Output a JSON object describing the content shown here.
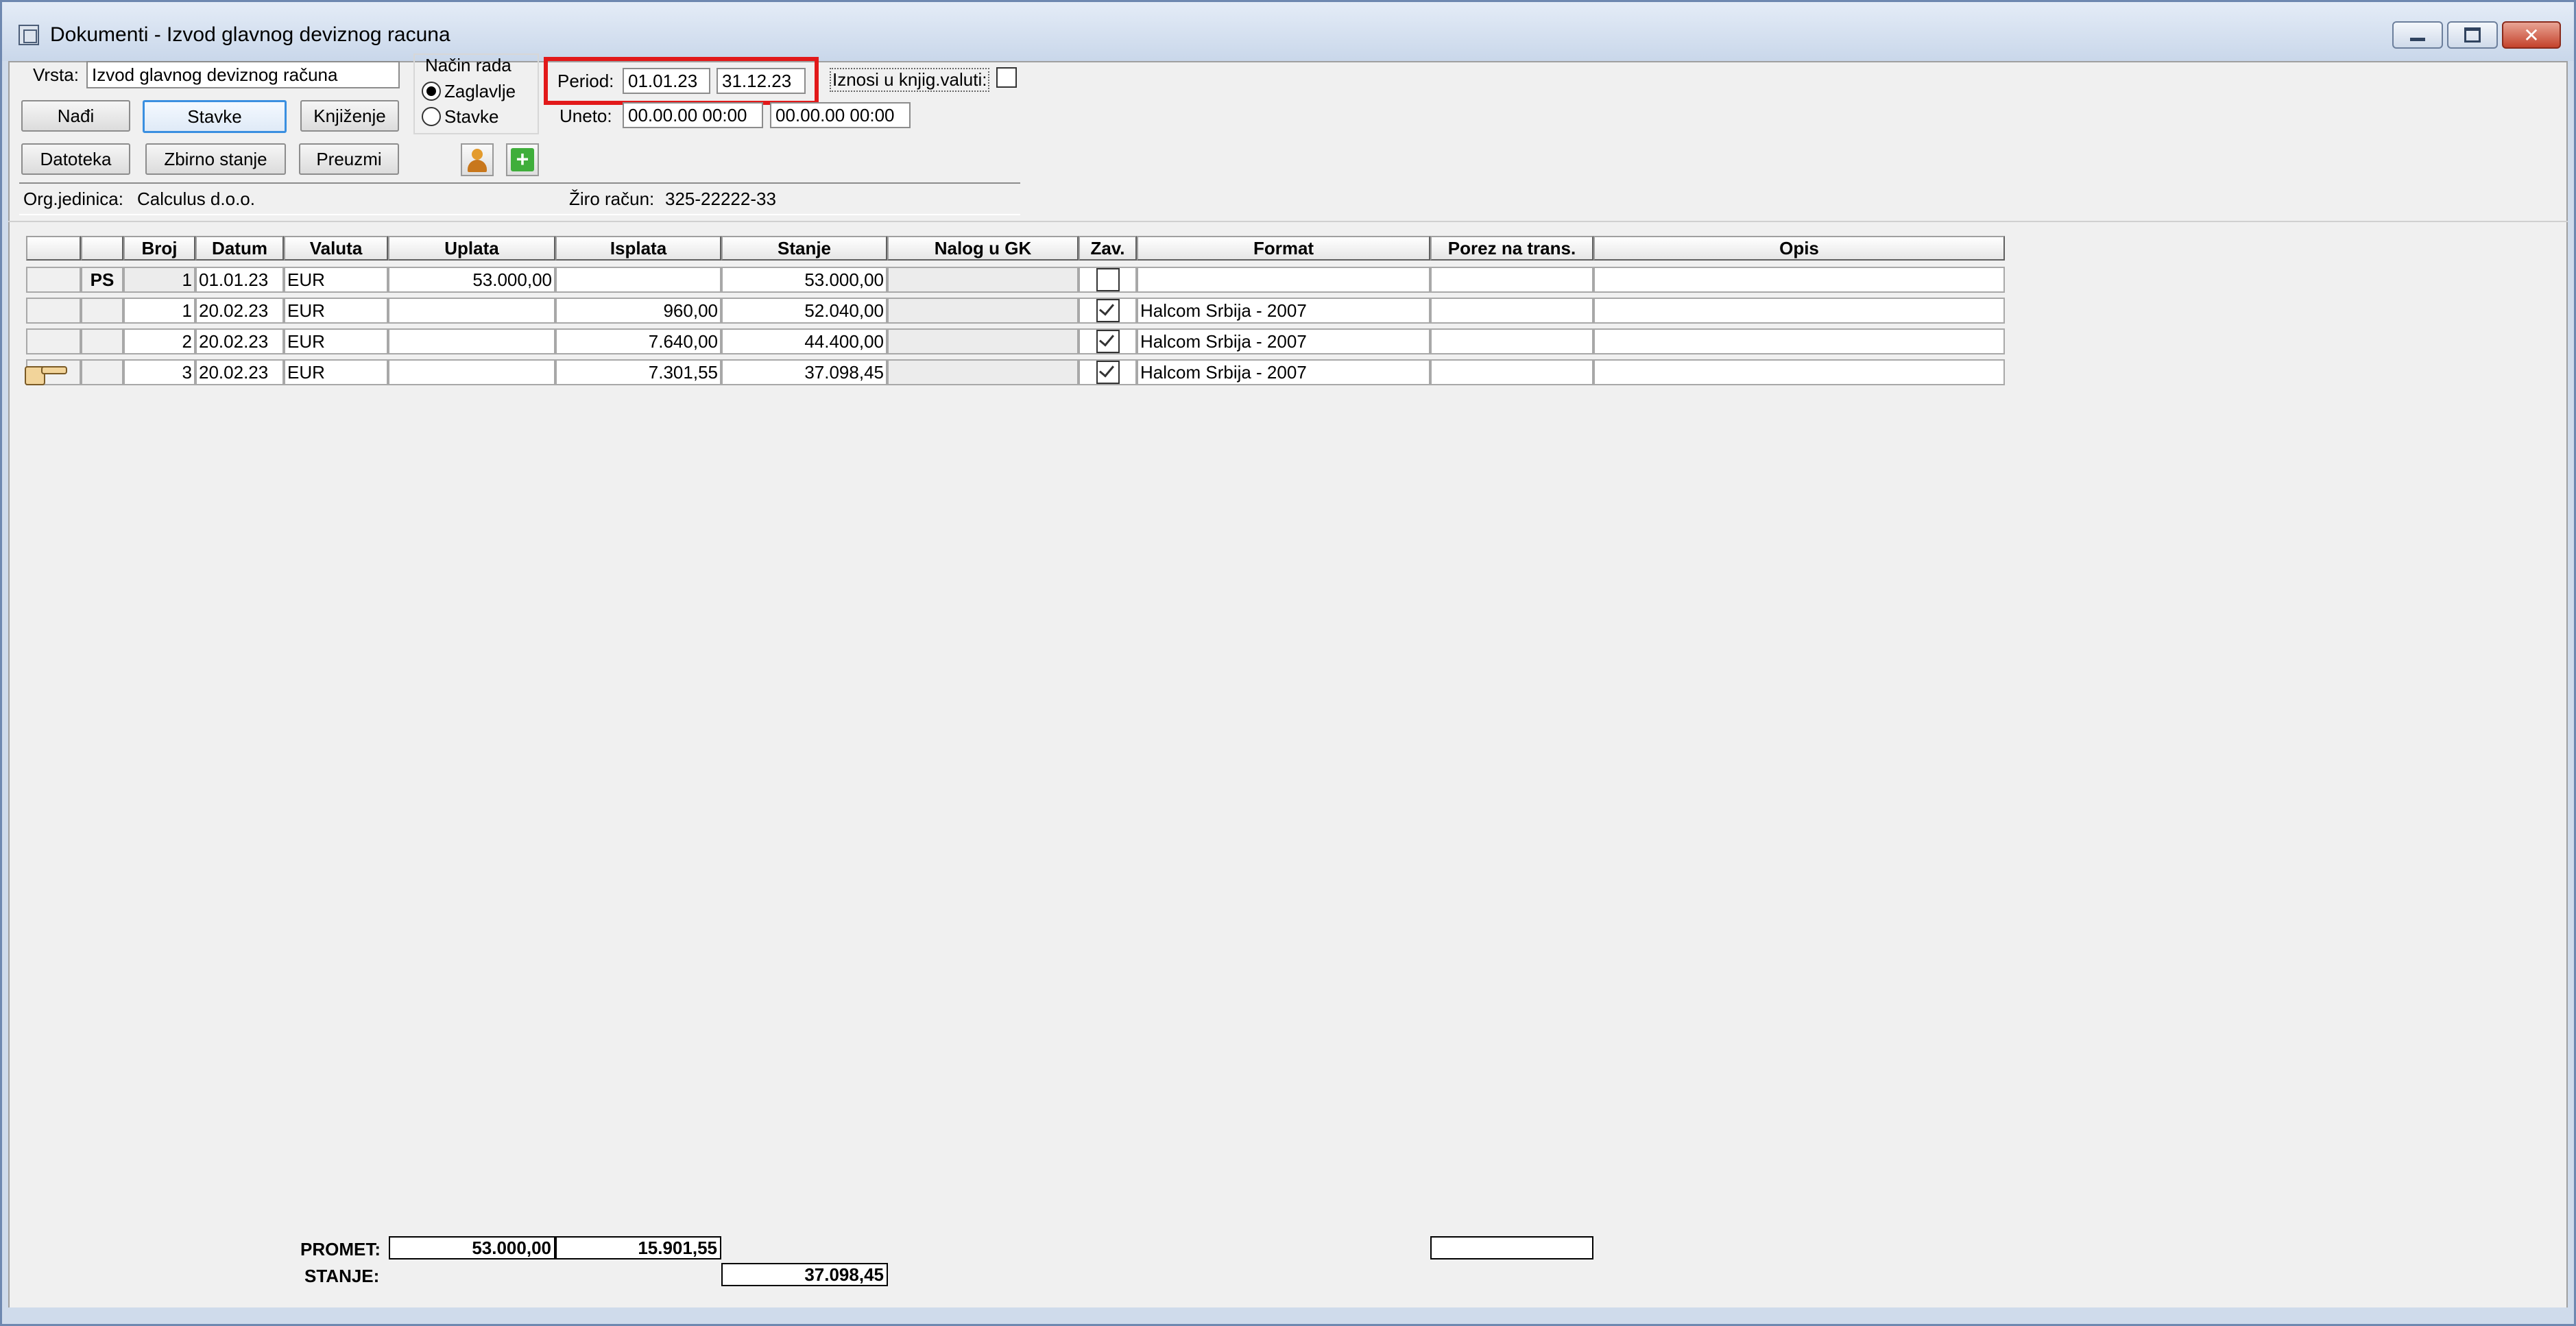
{
  "window": {
    "title": "Dokumenti - Izvod glavnog deviznog racuna",
    "close_glyph": "✕"
  },
  "form": {
    "vrsta_label": "Vrsta:",
    "vrsta_value": "Izvod glavnog deviznog računa",
    "nacin_rada_label": "Način rada",
    "mode_header_label": "Zaglavlje",
    "mode_items_label": "Stavke",
    "mode_selected": "Zaglavlje",
    "period_label": "Period:",
    "period_from": "01.01.23",
    "period_to": "31.12.23",
    "iznosi_label": "Iznosi u knjig.valuti:",
    "iznosi_checked": false,
    "uneto_label": "Uneto:",
    "uneto_from": "00.00.00 00:00",
    "uneto_to": "00.00.00 00:00",
    "org_label": "Org.jedinica:",
    "org_value": "Calculus d.o.o.",
    "ziro_label": "Žiro račun:",
    "ziro_value": "325-22222-33"
  },
  "buttons": {
    "nadji": "Nađi",
    "stavke": "Stavke",
    "knjizenje": "Knjiženje",
    "datoteka": "Datoteka",
    "zbirno_stanje": "Zbirno stanje",
    "preuzmi": "Preuzmi"
  },
  "table": {
    "columns": [
      "Broj",
      "Datum",
      "Valuta",
      "Uplata",
      "Isplata",
      "Stanje",
      "Nalog u GK",
      "Zav.",
      "Format",
      "Porez na trans.",
      "Opis"
    ],
    "rows": [
      {
        "marker": "PS",
        "broj": "1",
        "datum": "01.01.23",
        "valuta": "EUR",
        "uplata": "53.000,00",
        "isplata": "",
        "stanje": "53.000,00",
        "nalog": "",
        "zav": false,
        "format": "",
        "porez": "",
        "opis": ""
      },
      {
        "marker": "",
        "broj": "1",
        "datum": "20.02.23",
        "valuta": "EUR",
        "uplata": "",
        "isplata": "960,00",
        "stanje": "52.040,00",
        "nalog": "",
        "zav": true,
        "format": "Halcom Srbija - 2007",
        "porez": "",
        "opis": ""
      },
      {
        "marker": "",
        "broj": "2",
        "datum": "20.02.23",
        "valuta": "EUR",
        "uplata": "",
        "isplata": "7.640,00",
        "stanje": "44.400,00",
        "nalog": "",
        "zav": true,
        "format": "Halcom Srbija - 2007",
        "porez": "",
        "opis": ""
      },
      {
        "marker": "",
        "broj": "3",
        "datum": "20.02.23",
        "valuta": "EUR",
        "uplata": "",
        "isplata": "7.301,55",
        "stanje": "37.098,45",
        "nalog": "",
        "zav": true,
        "format": "Halcom Srbija - 2007",
        "porez": "",
        "opis": ""
      }
    ],
    "current_row": 3
  },
  "totals": {
    "promet_label": "PROMET:",
    "promet_uplata": "53.000,00",
    "promet_isplata": "15.901,55",
    "promet_porez": "",
    "stanje_label": "STANJE:",
    "stanje_value": "37.098,45"
  },
  "colors": {
    "highlight": "#e2191a",
    "focus": "#3a8fe0"
  }
}
